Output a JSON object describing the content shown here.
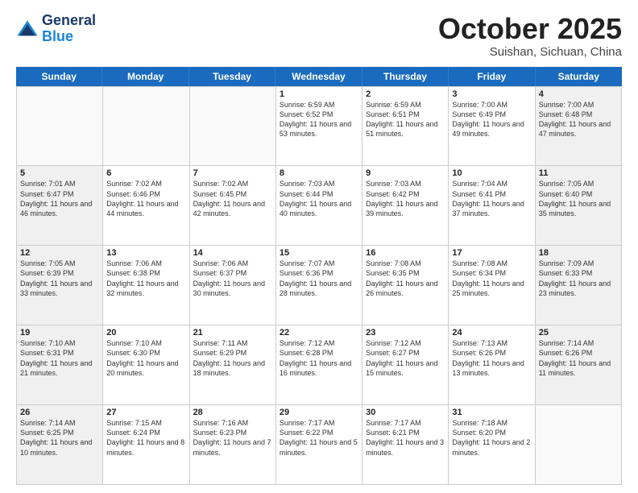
{
  "header": {
    "logo_general": "General",
    "logo_blue": "Blue",
    "month": "October 2025",
    "location": "Suishan, Sichuan, China"
  },
  "days_of_week": [
    "Sunday",
    "Monday",
    "Tuesday",
    "Wednesday",
    "Thursday",
    "Friday",
    "Saturday"
  ],
  "weeks": [
    [
      {
        "day": "",
        "info": ""
      },
      {
        "day": "",
        "info": ""
      },
      {
        "day": "",
        "info": ""
      },
      {
        "day": "1",
        "info": "Sunrise: 6:59 AM\nSunset: 6:52 PM\nDaylight: 11 hours and 53 minutes."
      },
      {
        "day": "2",
        "info": "Sunrise: 6:59 AM\nSunset: 6:51 PM\nDaylight: 11 hours and 51 minutes."
      },
      {
        "day": "3",
        "info": "Sunrise: 7:00 AM\nSunset: 6:49 PM\nDaylight: 11 hours and 49 minutes."
      },
      {
        "day": "4",
        "info": "Sunrise: 7:00 AM\nSunset: 6:48 PM\nDaylight: 11 hours and 47 minutes."
      }
    ],
    [
      {
        "day": "5",
        "info": "Sunrise: 7:01 AM\nSunset: 6:47 PM\nDaylight: 11 hours and 46 minutes."
      },
      {
        "day": "6",
        "info": "Sunrise: 7:02 AM\nSunset: 6:46 PM\nDaylight: 11 hours and 44 minutes."
      },
      {
        "day": "7",
        "info": "Sunrise: 7:02 AM\nSunset: 6:45 PM\nDaylight: 11 hours and 42 minutes."
      },
      {
        "day": "8",
        "info": "Sunrise: 7:03 AM\nSunset: 6:44 PM\nDaylight: 11 hours and 40 minutes."
      },
      {
        "day": "9",
        "info": "Sunrise: 7:03 AM\nSunset: 6:42 PM\nDaylight: 11 hours and 39 minutes."
      },
      {
        "day": "10",
        "info": "Sunrise: 7:04 AM\nSunset: 6:41 PM\nDaylight: 11 hours and 37 minutes."
      },
      {
        "day": "11",
        "info": "Sunrise: 7:05 AM\nSunset: 6:40 PM\nDaylight: 11 hours and 35 minutes."
      }
    ],
    [
      {
        "day": "12",
        "info": "Sunrise: 7:05 AM\nSunset: 6:39 PM\nDaylight: 11 hours and 33 minutes."
      },
      {
        "day": "13",
        "info": "Sunrise: 7:06 AM\nSunset: 6:38 PM\nDaylight: 11 hours and 32 minutes."
      },
      {
        "day": "14",
        "info": "Sunrise: 7:06 AM\nSunset: 6:37 PM\nDaylight: 11 hours and 30 minutes."
      },
      {
        "day": "15",
        "info": "Sunrise: 7:07 AM\nSunset: 6:36 PM\nDaylight: 11 hours and 28 minutes."
      },
      {
        "day": "16",
        "info": "Sunrise: 7:08 AM\nSunset: 6:35 PM\nDaylight: 11 hours and 26 minutes."
      },
      {
        "day": "17",
        "info": "Sunrise: 7:08 AM\nSunset: 6:34 PM\nDaylight: 11 hours and 25 minutes."
      },
      {
        "day": "18",
        "info": "Sunrise: 7:09 AM\nSunset: 6:33 PM\nDaylight: 11 hours and 23 minutes."
      }
    ],
    [
      {
        "day": "19",
        "info": "Sunrise: 7:10 AM\nSunset: 6:31 PM\nDaylight: 11 hours and 21 minutes."
      },
      {
        "day": "20",
        "info": "Sunrise: 7:10 AM\nSunset: 6:30 PM\nDaylight: 11 hours and 20 minutes."
      },
      {
        "day": "21",
        "info": "Sunrise: 7:11 AM\nSunset: 6:29 PM\nDaylight: 11 hours and 18 minutes."
      },
      {
        "day": "22",
        "info": "Sunrise: 7:12 AM\nSunset: 6:28 PM\nDaylight: 11 hours and 16 minutes."
      },
      {
        "day": "23",
        "info": "Sunrise: 7:12 AM\nSunset: 6:27 PM\nDaylight: 11 hours and 15 minutes."
      },
      {
        "day": "24",
        "info": "Sunrise: 7:13 AM\nSunset: 6:26 PM\nDaylight: 11 hours and 13 minutes."
      },
      {
        "day": "25",
        "info": "Sunrise: 7:14 AM\nSunset: 6:26 PM\nDaylight: 11 hours and 11 minutes."
      }
    ],
    [
      {
        "day": "26",
        "info": "Sunrise: 7:14 AM\nSunset: 6:25 PM\nDaylight: 11 hours and 10 minutes."
      },
      {
        "day": "27",
        "info": "Sunrise: 7:15 AM\nSunset: 6:24 PM\nDaylight: 11 hours and 8 minutes."
      },
      {
        "day": "28",
        "info": "Sunrise: 7:16 AM\nSunset: 6:23 PM\nDaylight: 11 hours and 7 minutes."
      },
      {
        "day": "29",
        "info": "Sunrise: 7:17 AM\nSunset: 6:22 PM\nDaylight: 11 hours and 5 minutes."
      },
      {
        "day": "30",
        "info": "Sunrise: 7:17 AM\nSunset: 6:21 PM\nDaylight: 11 hours and 3 minutes."
      },
      {
        "day": "31",
        "info": "Sunrise: 7:18 AM\nSunset: 6:20 PM\nDaylight: 11 hours and 2 minutes."
      },
      {
        "day": "",
        "info": ""
      }
    ]
  ]
}
